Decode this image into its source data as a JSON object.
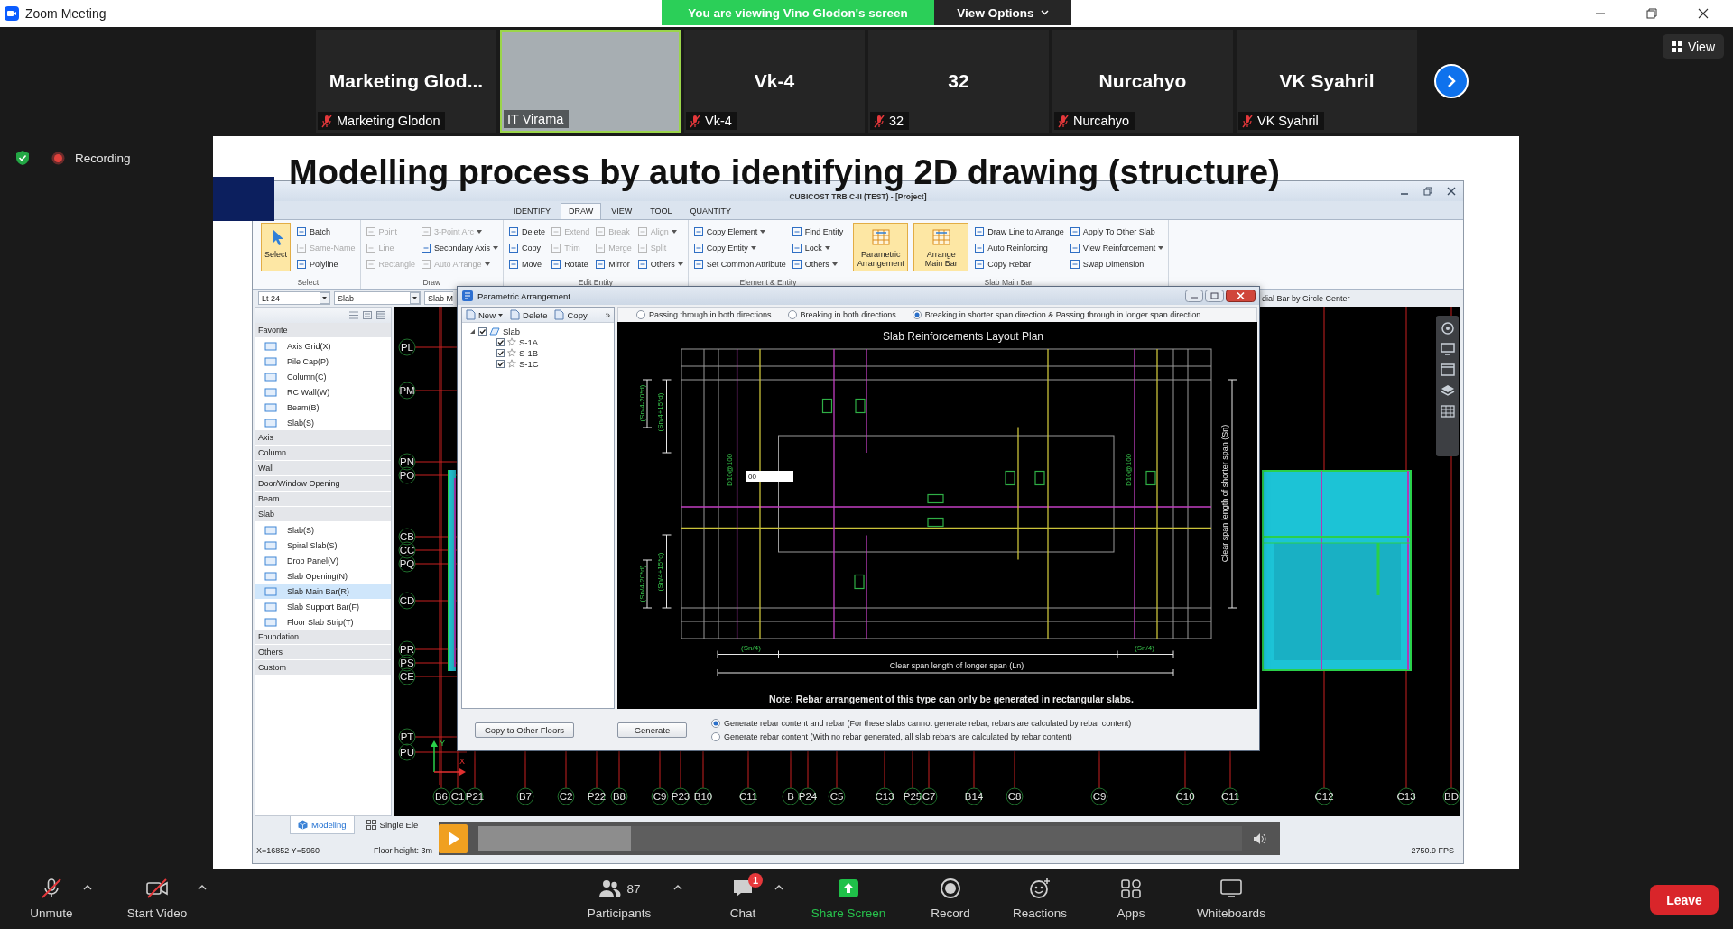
{
  "window": {
    "title": "Zoom Meeting",
    "banner": "You are viewing Vino Glodon's screen",
    "view_options": "View Options"
  },
  "participants": [
    {
      "kind": "name",
      "name": "Marketing Glod...",
      "label": "Marketing Glodon",
      "muted": true,
      "active_speaker": false
    },
    {
      "kind": "video",
      "label": "IT Virama",
      "muted": false,
      "active_speaker": true
    },
    {
      "kind": "name",
      "name": "Vk-4",
      "label": "Vk-4",
      "muted": true,
      "active_speaker": false
    },
    {
      "kind": "name",
      "name": "32",
      "label": "32",
      "muted": true,
      "active_speaker": false
    },
    {
      "kind": "name",
      "name": "Nurcahyo",
      "label": "Nurcahyo",
      "muted": true,
      "active_speaker": false
    },
    {
      "kind": "name",
      "name": "VK Syahril",
      "label": "VK Syahril",
      "muted": true,
      "active_speaker": false
    }
  ],
  "view_button": "View",
  "recording": "Recording",
  "slide": {
    "title": "Modelling process by auto identifying 2D drawing (structure)",
    "player": {
      "level": 0.2
    }
  },
  "cad": {
    "title": "CUBICOST TRB C-II (TEST) - [Project]",
    "tabs": [
      {
        "label": "IDENTIFY",
        "selected": false
      },
      {
        "label": "DRAW",
        "selected": true
      },
      {
        "label": "VIEW",
        "selected": false
      },
      {
        "label": "TOOL",
        "selected": false
      },
      {
        "label": "QUANTITY",
        "selected": false
      }
    ],
    "ribbon": [
      {
        "label": "Select",
        "columns": [
          {
            "kind": "large",
            "label": "Select",
            "selected": true
          },
          {
            "kind": "stack",
            "items": [
              {
                "label": "Batch",
                "disabled": false,
                "dropdown": false
              },
              {
                "label": "Same-Name",
                "disabled": true,
                "dropdown": false
              },
              {
                "label": "Polyline",
                "disabled": false,
                "dropdown": false
              }
            ]
          }
        ]
      },
      {
        "label": "Draw",
        "columns": [
          {
            "kind": "stack",
            "items": [
              {
                "label": "Point",
                "disabled": true,
                "dropdown": false
              },
              {
                "label": "Line",
                "disabled": true,
                "dropdown": false
              },
              {
                "label": "Rectangle",
                "disabled": true,
                "dropdown": false
              }
            ]
          },
          {
            "kind": "stack",
            "items": [
              {
                "label": "3-Point Arc",
                "disabled": true,
                "dropdown": true
              },
              {
                "label": "Secondary Axis",
                "disabled": false,
                "dropdown": true
              },
              {
                "label": "Auto Arrange",
                "disabled": true,
                "dropdown": true
              }
            ]
          }
        ]
      },
      {
        "label": "Edit Entity",
        "columns": [
          {
            "kind": "stack",
            "items": [
              {
                "label": "Delete",
                "disabled": false,
                "dropdown": false
              },
              {
                "label": "Copy",
                "disabled": false,
                "dropdown": false
              },
              {
                "label": "Move",
                "disabled": false,
                "dropdown": false
              }
            ]
          },
          {
            "kind": "stack",
            "items": [
              {
                "label": "Extend",
                "disabled": true,
                "dropdown": false
              },
              {
                "label": "Trim",
                "disabled": true,
                "dropdown": false
              },
              {
                "label": "Rotate",
                "disabled": false,
                "dropdown": false
              }
            ]
          },
          {
            "kind": "stack",
            "items": [
              {
                "label": "Break",
                "disabled": true,
                "dropdown": false
              },
              {
                "label": "Merge",
                "disabled": true,
                "dropdown": false
              },
              {
                "label": "Mirror",
                "disabled": false,
                "dropdown": false
              }
            ]
          },
          {
            "kind": "stack",
            "items": [
              {
                "label": "Align",
                "disabled": true,
                "dropdown": true
              },
              {
                "label": "Split",
                "disabled": true,
                "dropdown": false
              },
              {
                "label": "Others",
                "disabled": false,
                "dropdown": true
              }
            ]
          }
        ]
      },
      {
        "label": "Element & Entity",
        "columns": [
          {
            "kind": "stack",
            "items": [
              {
                "label": "Copy Element",
                "disabled": false,
                "dropdown": true
              },
              {
                "label": "Copy Entity",
                "disabled": false,
                "dropdown": true
              },
              {
                "label": "Set Common Attribute",
                "disabled": false,
                "dropdown": false
              }
            ]
          },
          {
            "kind": "stack",
            "items": [
              {
                "label": "Find Entity",
                "disabled": false,
                "dropdown": false
              },
              {
                "label": "Lock",
                "disabled": false,
                "dropdown": true
              },
              {
                "label": "Others",
                "disabled": false,
                "dropdown": true
              }
            ]
          }
        ]
      },
      {
        "label": "Slab Main Bar",
        "columns": [
          {
            "kind": "large",
            "label": "Parametric Arrangement",
            "selected": true
          },
          {
            "kind": "large",
            "label": "Arrange Main Bar",
            "selected": true
          },
          {
            "kind": "stack",
            "items": [
              {
                "label": "Draw Line to Arrange",
                "disabled": false,
                "dropdown": false
              },
              {
                "label": "Auto Reinforcing",
                "disabled": false,
                "dropdown": false
              },
              {
                "label": "Copy Rebar",
                "disabled": false,
                "dropdown": false
              }
            ]
          },
          {
            "kind": "stack",
            "items": [
              {
                "label": "Apply To Other Slab",
                "disabled": false,
                "dropdown": false
              },
              {
                "label": "View Reinforcement",
                "disabled": false,
                "dropdown": true
              },
              {
                "label": "Swap Dimension",
                "disabled": false,
                "dropdown": false
              }
            ]
          }
        ]
      }
    ],
    "selectors": [
      "Lt 24",
      "Slab",
      "Slab M"
    ],
    "hint": "dial Bar by Circle Center",
    "panel": [
      {
        "label": "Favorite",
        "children": [
          {
            "label": "Axis Grid(X)",
            "selected": false
          },
          {
            "label": "Pile Cap(P)",
            "selected": false
          },
          {
            "label": "Column(C)",
            "selected": false
          },
          {
            "label": "RC Wall(W)",
            "selected": false
          },
          {
            "label": "Beam(B)",
            "selected": false
          },
          {
            "label": "Slab(S)",
            "selected": false
          }
        ]
      },
      {
        "label": "Axis"
      },
      {
        "label": "Column"
      },
      {
        "label": "Wall"
      },
      {
        "label": "Door/Window Opening"
      },
      {
        "label": "Beam"
      },
      {
        "label": "Slab",
        "children": [
          {
            "label": "Slab(S)",
            "selected": false
          },
          {
            "label": "Spiral Slab(S)",
            "selected": false
          },
          {
            "label": "Drop Panel(V)",
            "selected": false
          },
          {
            "label": "Slab Opening(N)",
            "selected": false
          },
          {
            "label": "Slab Main Bar(R)",
            "selected": true
          },
          {
            "label": "Slab Support Bar(F)",
            "selected": false
          },
          {
            "label": "Floor Slab Strip(T)",
            "selected": false
          }
        ]
      },
      {
        "label": "Foundation"
      },
      {
        "label": "Others"
      },
      {
        "label": "Custom"
      }
    ],
    "axes_left": [
      "PL",
      "PM",
      "PN",
      "PO",
      "CB",
      "CC",
      "PQ",
      "CD",
      "PR",
      "PS",
      "CE",
      "PT",
      "PU"
    ],
    "axes_bottom": [
      "B6",
      "C1",
      "P21",
      "B7",
      "C2",
      "P22",
      "B8",
      "C9",
      "P23",
      "B10",
      "C11",
      "B",
      "P24",
      "C5",
      "C13",
      "P25",
      "C7",
      "B14",
      "C8",
      "C9",
      "C10",
      "C11",
      "C12",
      "C13",
      "BD"
    ],
    "axis_indicator": {
      "x": "X",
      "y": "Y"
    },
    "dialog": {
      "title": "Parametric Arrangement",
      "toolbar": [
        {
          "label": "New",
          "dropdown": true
        },
        {
          "label": "Delete",
          "dropdown": false
        },
        {
          "label": "Copy",
          "dropdown": false
        }
      ],
      "more": "»",
      "tree": {
        "label": "Slab",
        "checked": true,
        "expanded": true,
        "children": [
          {
            "label": "S-1A",
            "checked": true
          },
          {
            "label": "S-1B",
            "checked": true
          },
          {
            "label": "S-1C",
            "checked": true
          }
        ]
      },
      "layout_options": [
        {
          "label": "Passing through in both directions",
          "selected": false
        },
        {
          "label": "Breaking in both directions",
          "selected": false
        },
        {
          "label": "Breaking in shorter span direction & Passing through in longer span direction",
          "selected": true
        }
      ],
      "plan": {
        "title": "Slab Reinforcements Layout Plan",
        "upper_dims": [
          "(Sn/4-20*d)",
          "(Sn/4+15*d)"
        ],
        "lower_dims": [
          "(Sn/4-20*d)",
          "(Sn/4+15*d)"
        ],
        "bar_specs": [
          "D10@100",
          "D10@100"
        ],
        "edit_value": "00",
        "short_span": "Clear span length of shorter span (Sn)",
        "quarter_spans": [
          "(Sn/4)",
          "(Sn/4)"
        ],
        "long_span": "Clear span length of longer span (Ln)",
        "note": "Note: Rebar arrangement of this type can only be generated in rectangular slabs."
      },
      "copy_button": "Copy to Other Floors",
      "generate_button": "Generate",
      "generate_options": [
        {
          "label": "Generate rebar content and rebar (For these slabs cannot generate rebar, rebars are calculated by rebar content)",
          "selected": true
        },
        {
          "label": "Generate rebar content (With no rebar generated, all slab rebars are calculated by rebar content)",
          "selected": false
        }
      ]
    },
    "bottom_tabs": [
      {
        "label": "Modeling",
        "selected": true
      },
      {
        "label": "Single Ele",
        "selected": false
      }
    ],
    "status": [
      "X=16852 Y=5960",
      "Floor height: 3m",
      "2750.9 FPS"
    ]
  },
  "toolbar": {
    "left": [
      {
        "kind": "microphone",
        "label": "Unmute",
        "off": true,
        "menu": true
      },
      {
        "kind": "camera",
        "label": "Start Video",
        "off": true,
        "menu": true
      }
    ],
    "center": [
      {
        "kind": "participants",
        "label": "Participants",
        "count": "87",
        "menu": true
      },
      {
        "kind": "chat",
        "label": "Chat",
        "badge": "1",
        "menu": true
      },
      {
        "kind": "share",
        "label": "Share Screen",
        "menu": false
      },
      {
        "kind": "record",
        "label": "Record",
        "menu": false
      },
      {
        "kind": "reactions",
        "label": "Reactions",
        "menu": false
      },
      {
        "kind": "apps",
        "label": "Apps",
        "menu": false
      },
      {
        "kind": "whiteboard",
        "label": "Whiteboards",
        "menu": false
      }
    ],
    "leave": "Leave"
  }
}
